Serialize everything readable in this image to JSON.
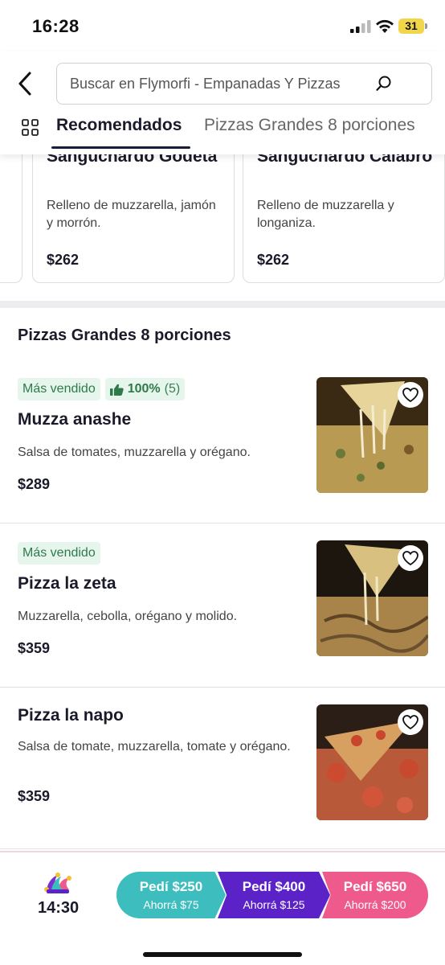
{
  "status_bar": {
    "time": "16:28",
    "battery": "31"
  },
  "search": {
    "placeholder": "Buscar en Flymorfi - Empanadas Y Pizzas"
  },
  "tabs": [
    {
      "label": "Recomendados",
      "active": true
    },
    {
      "label": "Pizzas Grandes 8 porciones",
      "active": false
    }
  ],
  "recommended": [
    {
      "title": "Sanguchardo Godeta",
      "description": "Relleno de muzzarella, jamón y morrón.",
      "price": "$262"
    },
    {
      "title": "Sanguchardo Calabro",
      "description": "Relleno de muzzarella y longaniza.",
      "price": "$262"
    }
  ],
  "section": {
    "title": "Pizzas Grandes 8 porciones"
  },
  "products": [
    {
      "badge": "Más vendido",
      "rating_pct": "100%",
      "rating_count": "(5)",
      "name": "Muzza anashe",
      "description": "Salsa de tomates, muzzarella y orégano.",
      "price": "$289"
    },
    {
      "badge": "Más vendido",
      "name": "Pizza la zeta",
      "description": "Muzzarella, cebolla, orégano y molido.",
      "price": "$359"
    },
    {
      "name": "Pizza la napo",
      "description": "Salsa de tomate, muzzarella, tomate y orégano.",
      "price": "$359"
    }
  ],
  "bottom_bar": {
    "time": "14:30",
    "promos": [
      {
        "label": "Pedí $250",
        "saving": "Ahorrá $75",
        "color": "#3dbdbd"
      },
      {
        "label": "Pedí $400",
        "saving": "Ahorrá $125",
        "color": "#5b22c8"
      },
      {
        "label": "Pedí $650",
        "saving": "Ahorrá $200",
        "color": "#ef5a8c"
      }
    ]
  },
  "colors": {
    "badge_bg": "#e6f6ec",
    "badge_text": "#2f7a4b",
    "tab_indicator": "#1a1a3a"
  },
  "icons": [
    "back-arrow-icon",
    "search-icon",
    "grid-icon",
    "thumbs-up-icon",
    "heart-icon",
    "jester-hat-icon"
  ]
}
